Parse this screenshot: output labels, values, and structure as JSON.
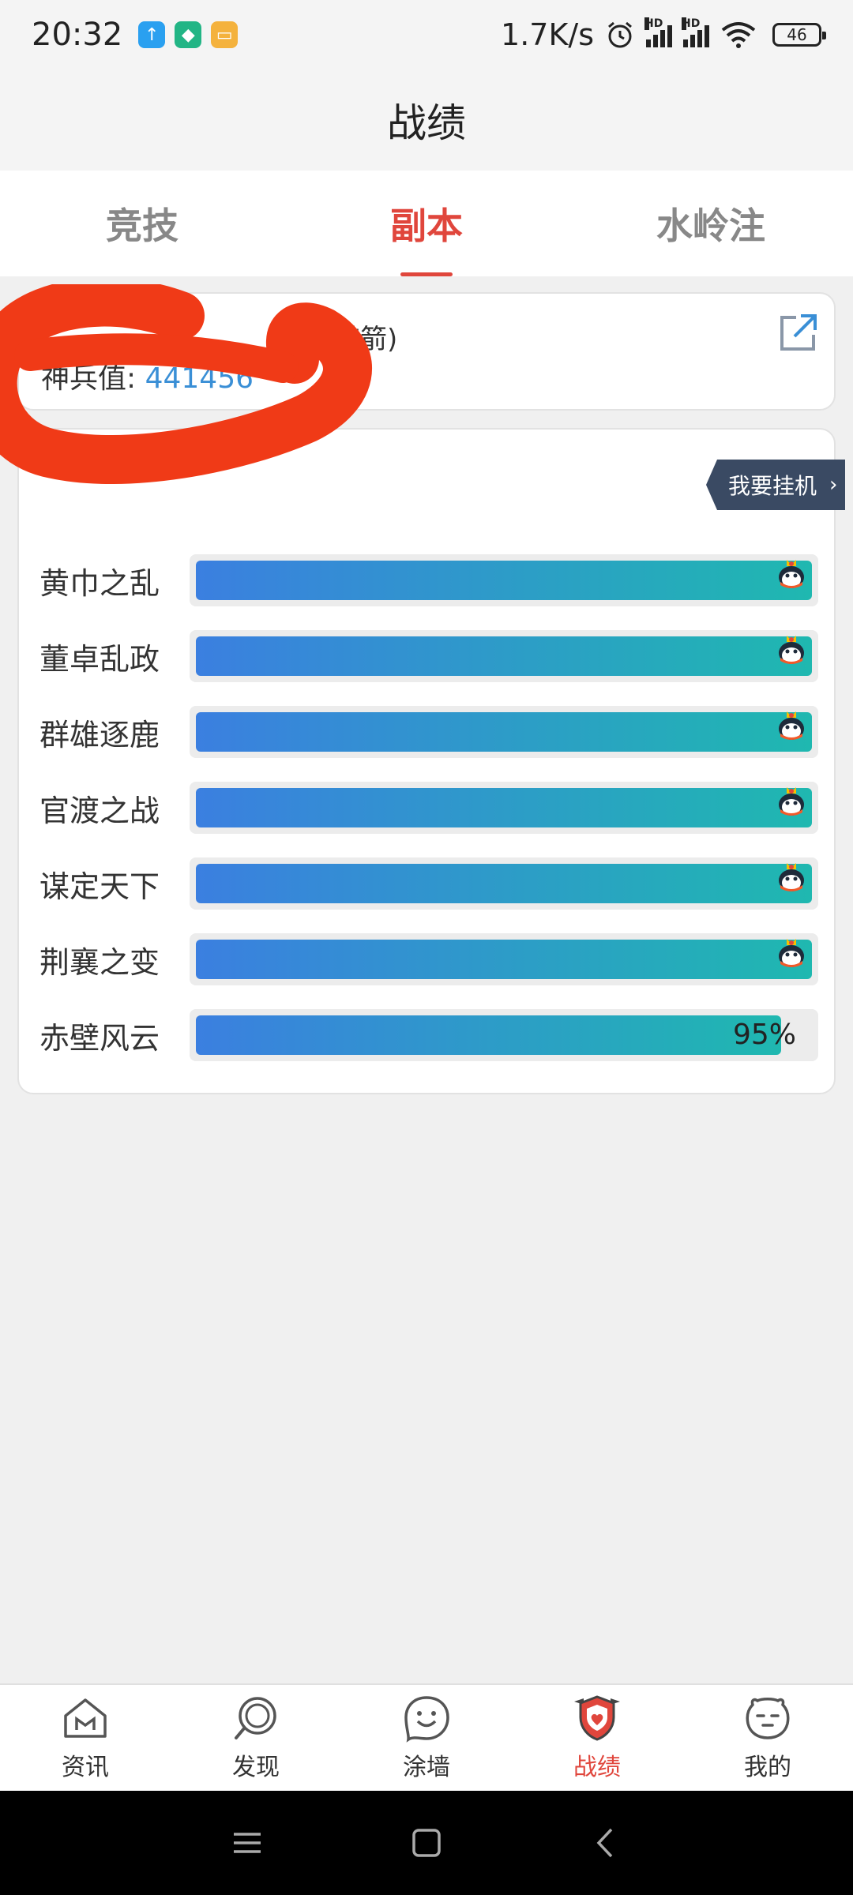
{
  "status_bar": {
    "time": "20:32",
    "net_speed": "1.7K/s",
    "battery": "46",
    "notifications": [
      {
        "name": "upload-icon",
        "color": "#2aa0f0",
        "glyph": "↑"
      },
      {
        "name": "shield-app-icon",
        "color": "#22b585",
        "glyph": "◆"
      },
      {
        "name": "message-app-icon",
        "color": "#f4b23d",
        "glyph": "▭"
      }
    ]
  },
  "header": {
    "title": "战绩"
  },
  "tabs": [
    {
      "label": "竞技",
      "active": false
    },
    {
      "label": "副本",
      "active": true
    },
    {
      "label": "水岭注",
      "active": false
    }
  ],
  "profile": {
    "name_visible_suffix": "借箭)",
    "score_label": "神兵值: ",
    "score_value": "441456"
  },
  "progress": {
    "idle_button_label": "我要挂机",
    "rows": [
      {
        "label": "黄巾之乱",
        "progress": 100,
        "completed": true
      },
      {
        "label": "董卓乱政",
        "progress": 100,
        "completed": true
      },
      {
        "label": "群雄逐鹿",
        "progress": 100,
        "completed": true
      },
      {
        "label": "官渡之战",
        "progress": 100,
        "completed": true
      },
      {
        "label": "谋定天下",
        "progress": 100,
        "completed": true
      },
      {
        "label": "荆襄之变",
        "progress": 100,
        "completed": true
      },
      {
        "label": "赤壁风云",
        "progress": 95,
        "completed": false,
        "pct_text": "95%"
      }
    ]
  },
  "bottom_nav": [
    {
      "label": "资讯",
      "icon": "house-icon",
      "active": false
    },
    {
      "label": "发现",
      "icon": "search-icon",
      "active": false
    },
    {
      "label": "涂墙",
      "icon": "smile-icon",
      "active": false
    },
    {
      "label": "战绩",
      "icon": "shield-icon",
      "active": true
    },
    {
      "label": "我的",
      "icon": "face-icon",
      "active": false
    }
  ],
  "colors": {
    "accent": "#e0463c",
    "link": "#3a8fd6",
    "bar_start": "#3b7fe0",
    "bar_end": "#1fb8b0",
    "redaction": "#f03a17"
  }
}
